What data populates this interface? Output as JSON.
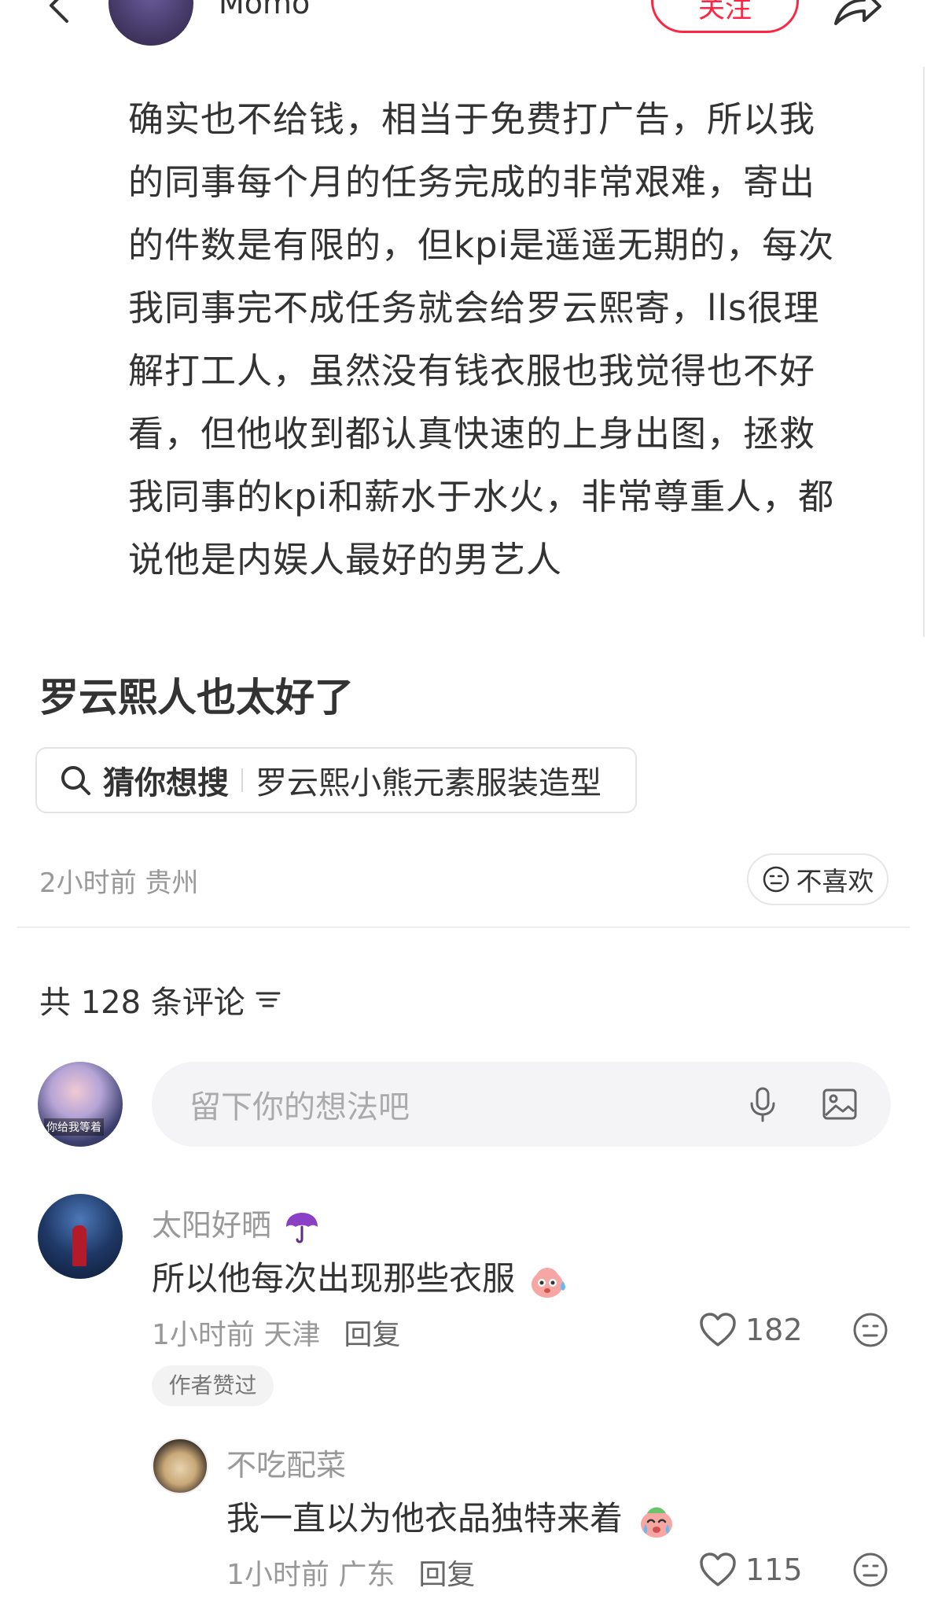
{
  "header": {
    "author": "Momo",
    "follow_label": "关注"
  },
  "note": {
    "lines": [
      "确实也不给钱，相当于免费打广告，所以我",
      "的同事每个月的任务完成的非常艰难，寄出",
      "的件数是有限的，但kpi是遥遥无期的，每次",
      "我同事完不成任务就会给罗云熙寄，lls很理",
      "解打工人，虽然没有钱衣服也我觉得也不好",
      "看，但他收到都认真快速的上身出图，拯救",
      "我同事的kpi和薪水于水火，非常尊重人，都",
      "说他是内娱人最好的男艺人"
    ],
    "title": "罗云熙人也太好了",
    "search_guess_label": "猜你想搜",
    "search_query": "罗云熙小熊元素服装造型",
    "time_location": "2小时前 贵州",
    "dislike_label": "不喜欢"
  },
  "comments_section": {
    "count_label": "共 128 条评论",
    "input_placeholder": "留下你的想法吧",
    "my_avatar_tag": "你给我等着"
  },
  "comments": [
    {
      "user": "太阳好晒",
      "text": "所以他每次出现那些衣服",
      "time_location": "1小时前 天津",
      "reply_label": "回复",
      "likes": "182",
      "badge": "作者赞过"
    },
    {
      "user": "不吃配菜",
      "text": "我一直以为他衣品独特来着",
      "time_location": "1小时前 广东",
      "reply_label": "回复",
      "likes": "115"
    }
  ],
  "colors": {
    "accent": "#ff2442",
    "muted_text": "#999999",
    "body_text": "#333333"
  },
  "icons": [
    "back-icon",
    "share-icon",
    "search-icon",
    "dislike-face-icon",
    "sort-icon",
    "microphone-icon",
    "image-icon",
    "umbrella-icon",
    "heart-icon",
    "emoji-face-icon",
    "sweat-emoji-icon",
    "crying-emoji-icon"
  ]
}
